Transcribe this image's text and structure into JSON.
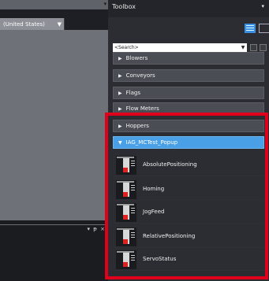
{
  "left_panel": {
    "locale_label": "(United States)",
    "dropdown_glyph": "▼",
    "top_arrow": "▾",
    "panel_controls": "▾ ᵽ ×"
  },
  "toolbox": {
    "title": "Toolbox",
    "pin_glyph": "▾",
    "search_placeholder": "<Search>",
    "search_dd": "▼",
    "categories": [
      {
        "label": "Blowers",
        "expanded": false
      },
      {
        "label": "Conveyors",
        "expanded": false
      },
      {
        "label": "Flags",
        "expanded": false
      },
      {
        "label": "Flow Meters",
        "expanded": false
      },
      {
        "label": "Hoppers",
        "expanded": false
      },
      {
        "label": "IAG_MCTest_Popup",
        "expanded": true
      }
    ],
    "items": [
      {
        "label": "AbsolutePositioning",
        "icon": "servo-drive-icon"
      },
      {
        "label": "Homing",
        "icon": "servo-drive-icon"
      },
      {
        "label": "JogFeed",
        "icon": "servo-drive-icon"
      },
      {
        "label": "RelativePositioning",
        "icon": "servo-drive-icon"
      },
      {
        "label": "ServoStatus",
        "icon": "servo-drive-icon"
      }
    ],
    "glyphs": {
      "collapsed": "▶",
      "expanded": "▼"
    }
  },
  "colors": {
    "accent": "#4aa0e6",
    "highlight_box": "#e0001b"
  }
}
